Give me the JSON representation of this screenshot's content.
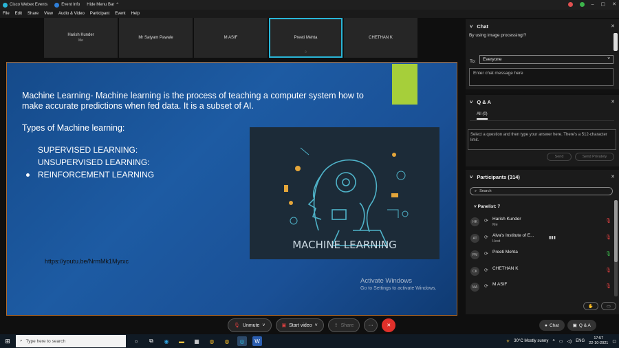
{
  "titlebar": {
    "app_name": "Cisco Webex Events",
    "event_info": "Event Info",
    "hide_menu": "Hide Menu Bar"
  },
  "menu": [
    "File",
    "Edit",
    "Share",
    "View",
    "Audio & Video",
    "Participant",
    "Event",
    "Help"
  ],
  "videos": [
    {
      "name": "Harish Kunder",
      "sub": "Me",
      "active": false
    },
    {
      "name": "Mr Satyam Pawale",
      "sub": "",
      "active": false
    },
    {
      "name": "M ASIF",
      "sub": "",
      "active": false
    },
    {
      "name": "Preeti Mehta",
      "sub": "",
      "active": true
    },
    {
      "name": "CHETHAN K",
      "sub": "",
      "active": false
    }
  ],
  "slide": {
    "definition": "Machine Learning- Machine learning is the process of teaching a computer system how to make accurate predictions when fed data. It is a subset of AI.",
    "types_heading": "Types of Machine learning:",
    "items": [
      "SUPERVISED LEARNING:",
      "UNSUPERVISED LEARNING:",
      "REINFORCEMENT LEARNING"
    ],
    "image_caption": "MACHINE LEARNING",
    "link": "https://youtu.be/NrmMk1Myrxc",
    "watermark_title": "Activate Windows",
    "watermark_sub": "Go to Settings to activate Windows."
  },
  "controls": {
    "unmute": "Unmute",
    "start_video": "Start video",
    "share": "Share"
  },
  "chat": {
    "title": "Chat",
    "message": "By using image processing!?",
    "to_label": "To:",
    "to_value": "Everyone",
    "input_placeholder": "Enter chat message here"
  },
  "qa": {
    "title": "Q & A",
    "tab": "All (0)",
    "box_text": "Select a question and then type your answer here. There's a 512-character limit.",
    "send": "Send",
    "send_privately": "Send Privately"
  },
  "participants": {
    "title": "Participants (314)",
    "search_placeholder": "Search",
    "panelist_heading": "Panelist: 7",
    "list": [
      {
        "initials": "HK",
        "name": "Harish Kunder",
        "role": "Me",
        "mic_on": false
      },
      {
        "initials": "AT",
        "name": "Alva's Institute of E...",
        "role": "Host",
        "mic_on": false
      },
      {
        "initials": "PM",
        "name": "Preeti Mehta",
        "role": "",
        "mic_on": true
      },
      {
        "initials": "CK",
        "name": "CHETHAN K",
        "role": "",
        "mic_on": false
      },
      {
        "initials": "MA",
        "name": "M ASIF",
        "role": "",
        "mic_on": false
      }
    ]
  },
  "bottom_tabs": {
    "chat": "Chat",
    "qa": "Q & A"
  },
  "taskbar": {
    "search_placeholder": "Type here to search",
    "weather": "30°C  Mostly sunny",
    "time": "17:57",
    "date": "22-10-2021"
  },
  "colors": {
    "accent": "#29b6d8",
    "slide_bg": "#1a5096",
    "green_block": "#a6cf3a",
    "end_call": "#e0302a"
  }
}
